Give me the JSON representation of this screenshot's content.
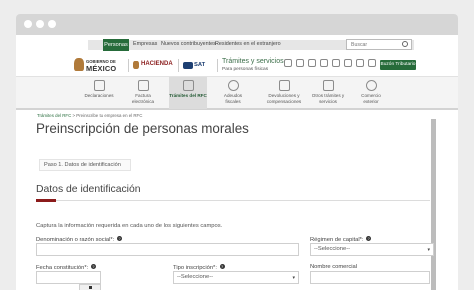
{
  "top_nav": {
    "active": "Personas",
    "links": [
      "Empresas",
      "Nuevos contribuyentes",
      "Residentes en el extranjero"
    ],
    "search_placeholder": "Buscar"
  },
  "header": {
    "gob_small": "GOBIERNO DE",
    "gob_big": "MÉXICO",
    "hacienda": "HACIENDA",
    "sat": "SAT",
    "tramites": "Trámites y servicios",
    "personas": "Para personas físicas",
    "buzon": "Buzón Tributario"
  },
  "menu": {
    "items": [
      {
        "label": "Declaraciones",
        "icon": "document-icon"
      },
      {
        "label": "Factura electrónica",
        "icon": "invoice-icon"
      },
      {
        "label": "Trámites del RFC",
        "icon": "rfc-icon",
        "selected": true
      },
      {
        "label": "Adeudos fiscales",
        "icon": "debt-icon"
      },
      {
        "label": "Devoluciones y compensaciones",
        "icon": "refund-icon"
      },
      {
        "label": "Otros trámites y servicios",
        "icon": "services-icon"
      },
      {
        "label": "Comercio exterior",
        "icon": "trade-icon"
      }
    ]
  },
  "breadcrumb": {
    "home": "Trámites del RFC",
    "current": "Preinscribe tu empresa en el RFC"
  },
  "page": {
    "title": "Preinscripción de personas morales",
    "step": "Paso 1. Datos de identificación",
    "section_title": "Datos de identificación",
    "intro": "Captura la información requerida en cada uno de los siguientes campos."
  },
  "form": {
    "razon_social_label": "Denominación o razón social*:",
    "regimen_label": "Régimen de capital*:",
    "regimen_value": "--Seleccione--",
    "fecha_label": "Fecha constitución*:",
    "tipo_label": "Tipo inscripción*:",
    "tipo_value": "--Seleccione--",
    "nombre_comercial_label": "Nombre comercial"
  }
}
